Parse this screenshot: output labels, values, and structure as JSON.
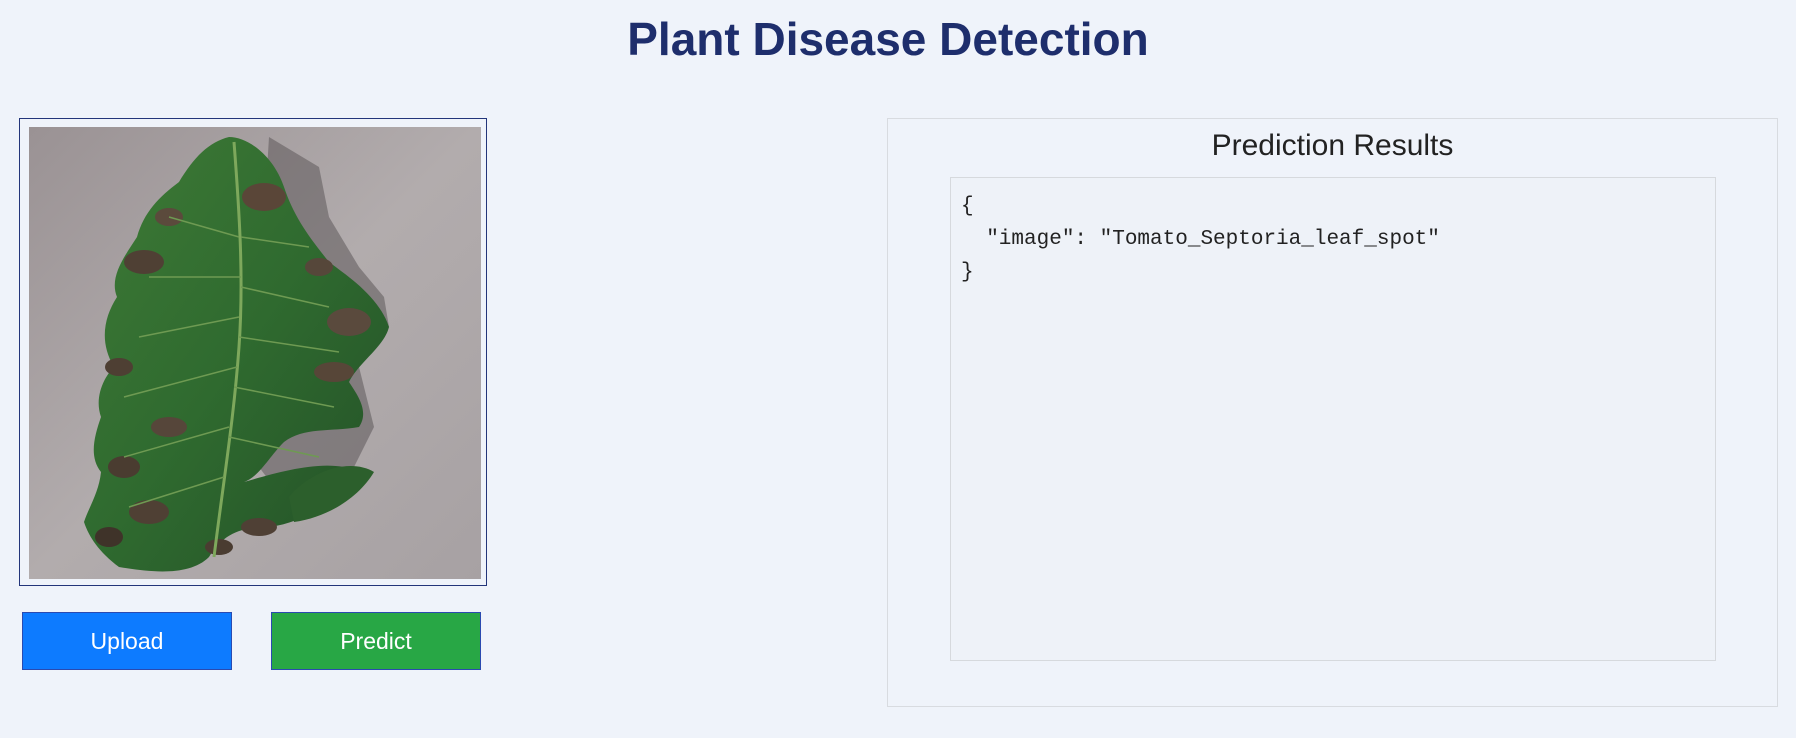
{
  "page": {
    "title": "Plant Disease Detection"
  },
  "image_panel": {
    "image_alt": "tomato-leaf-with-septoria-spots"
  },
  "buttons": {
    "upload_label": "Upload",
    "predict_label": "Predict"
  },
  "results": {
    "title": "Prediction Results",
    "json_text": "{\n  \"image\": \"Tomato_Septoria_leaf_spot\"\n}"
  },
  "colors": {
    "background": "#eff3fa",
    "title": "#1e2e6c",
    "upload_button": "#0d7bff",
    "predict_button": "#28a745"
  }
}
